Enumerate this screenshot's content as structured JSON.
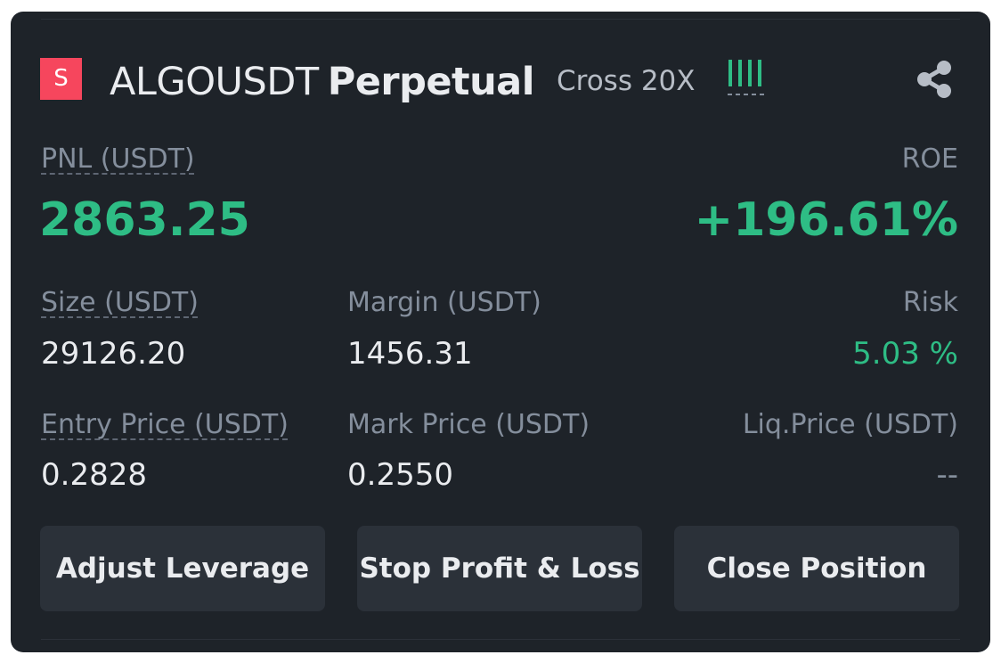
{
  "position": {
    "side_badge": "S",
    "symbol": "ALGOUSDT",
    "contract_type": "Perpetual",
    "margin_mode": "Cross 20X"
  },
  "colors": {
    "background": "#1e2329",
    "accent_green": "#2ebd85",
    "side_red": "#f6465d",
    "button": "#2b3139"
  },
  "icons": {
    "risk_level": "risk-bars-icon",
    "share": "share-icon"
  },
  "stats": {
    "pnl_label": "PNL (USDT)",
    "pnl_value": "2863.25",
    "roe_label": "ROE",
    "roe_value": "+196.61%",
    "size_label": "Size (USDT)",
    "size_value": "29126.20",
    "margin_label": "Margin (USDT)",
    "margin_value": "1456.31",
    "risk_label": "Risk",
    "risk_value": "5.03 %",
    "entry_price_label": "Entry Price (USDT)",
    "entry_price_value": "0.2828",
    "mark_price_label": "Mark Price (USDT)",
    "mark_price_value": "0.2550",
    "liq_price_label": "Liq.Price (USDT)",
    "liq_price_value": "--"
  },
  "actions": {
    "adjust_leverage": "Adjust Leverage",
    "stop_profit_loss": "Stop Profit & Loss",
    "close_position": "Close Position"
  }
}
